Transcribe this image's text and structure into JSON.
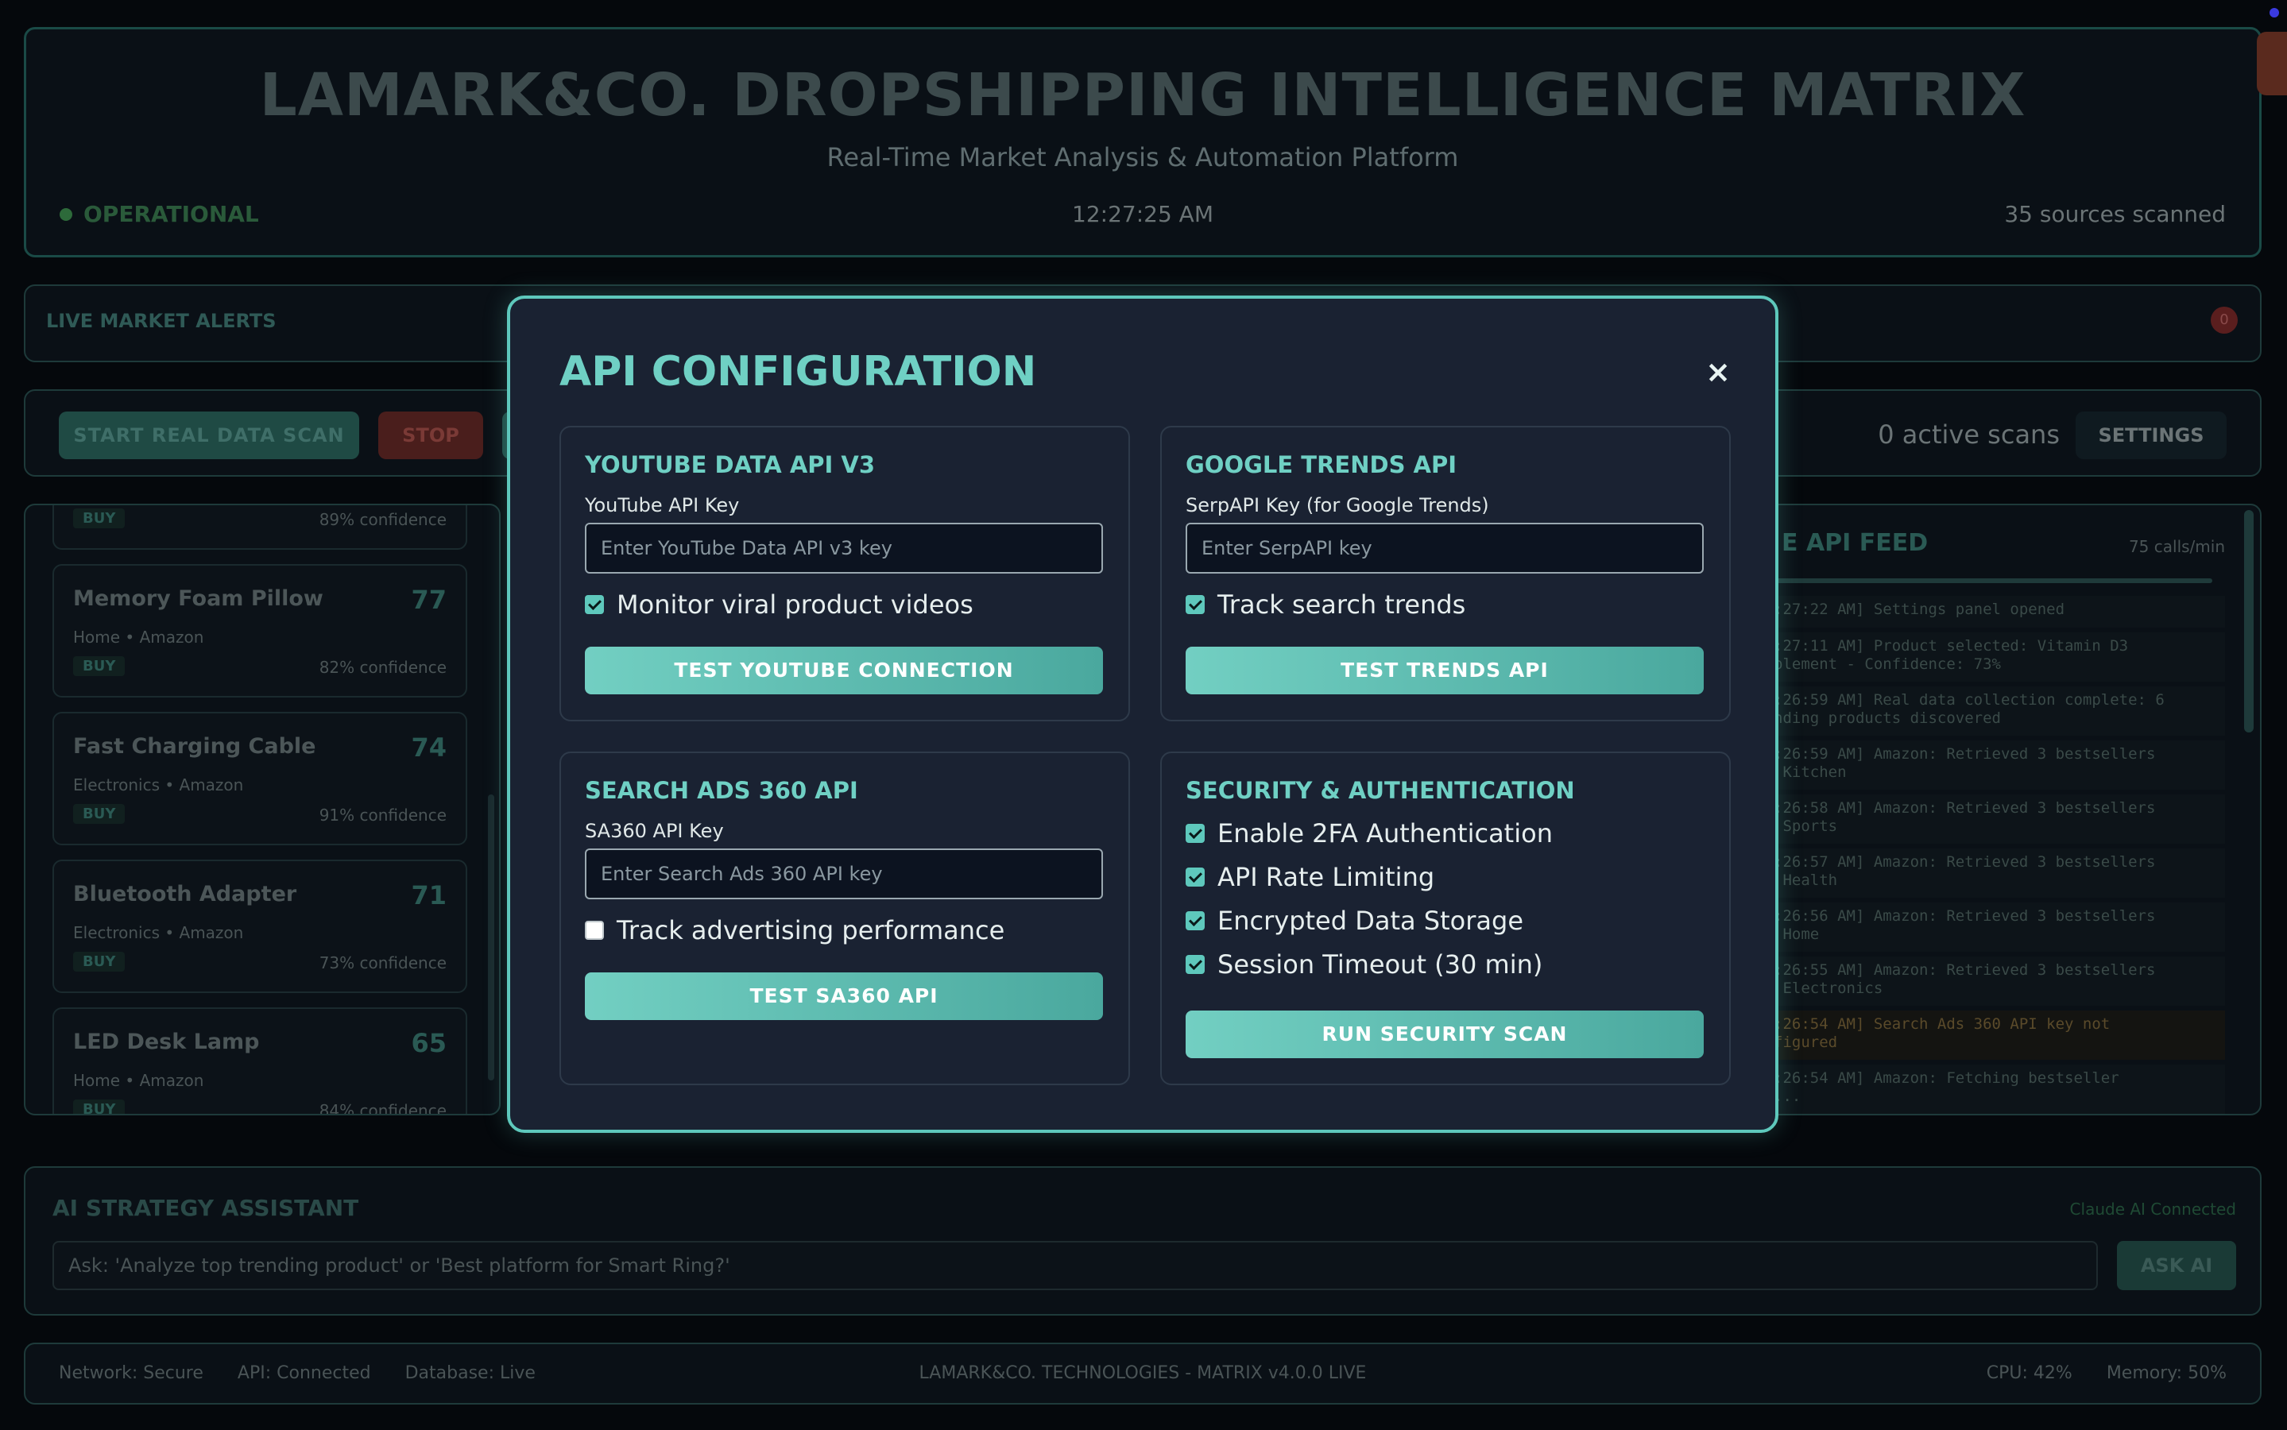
{
  "header": {
    "title": "LAMARK&CO. DROPSHIPPING INTELLIGENCE MATRIX",
    "subtitle": "Real-Time Market Analysis & Automation Platform",
    "status": "OPERATIONAL",
    "clock": "12:27:25 AM",
    "sources": "35 sources scanned"
  },
  "alerts": {
    "label": "LIVE MARKET ALERTS",
    "count": "0"
  },
  "controls": {
    "start_label": "START REAL DATA SCAN",
    "stop_label": "STOP",
    "active_scans": "0 active scans",
    "settings_label": "SETTINGS"
  },
  "products": [
    {
      "name": "",
      "score": "",
      "meta": "",
      "action": "BUY",
      "confidence": "89% confidence"
    },
    {
      "name": "Memory Foam Pillow",
      "score": "77",
      "meta": "Home • Amazon",
      "action": "BUY",
      "confidence": "82% confidence"
    },
    {
      "name": "Fast Charging Cable",
      "score": "74",
      "meta": "Electronics • Amazon",
      "action": "BUY",
      "confidence": "91% confidence"
    },
    {
      "name": "Bluetooth Adapter",
      "score": "71",
      "meta": "Electronics • Amazon",
      "action": "BUY",
      "confidence": "73% confidence"
    },
    {
      "name": "LED Desk Lamp",
      "score": "65",
      "meta": "Home • Amazon",
      "action": "BUY",
      "confidence": "84% confidence"
    }
  ],
  "feed": {
    "title": "E API FEED",
    "rate": "75 calls/min",
    "logs": [
      {
        "text": ":27:22 AM] Settings panel opened",
        "level": "info"
      },
      {
        "text": ":27:11 AM] Product selected: Vitamin D3\nplement - Confidence: 73%",
        "level": "info"
      },
      {
        "text": ":26:59 AM] Real data collection complete: 6\nnding products discovered",
        "level": "info"
      },
      {
        "text": ":26:59 AM] Amazon: Retrieved 3 bestsellers\n Kitchen",
        "level": "info"
      },
      {
        "text": ":26:58 AM] Amazon: Retrieved 3 bestsellers\n Sports",
        "level": "info"
      },
      {
        "text": ":26:57 AM] Amazon: Retrieved 3 bestsellers\n Health",
        "level": "info"
      },
      {
        "text": ":26:56 AM] Amazon: Retrieved 3 bestsellers\n Home",
        "level": "info"
      },
      {
        "text": ":26:55 AM] Amazon: Retrieved 3 bestsellers\n Electronics",
        "level": "info"
      },
      {
        "text": ":26:54 AM] Search Ads 360 API key not\nfigured",
        "level": "warn"
      },
      {
        "text": ":26:54 AM] Amazon: Fetching bestseller\n...",
        "level": "info"
      }
    ]
  },
  "ai": {
    "title": "AI STRATEGY ASSISTANT",
    "status": "Claude AI Connected",
    "placeholder": "Ask: 'Analyze top trending product' or 'Best platform for Smart Ring?'",
    "button": "ASK AI"
  },
  "footer": {
    "network": "Network: Secure",
    "api": "API: Connected",
    "database": "Database: Live",
    "center": "LAMARK&CO. TECHNOLOGIES - MATRIX v4.0.0 LIVE",
    "cpu": "CPU: 42%",
    "memory": "Memory: 50%"
  },
  "modal": {
    "title": "API CONFIGURATION",
    "close": "×",
    "youtube": {
      "title": "YOUTUBE DATA API V3",
      "field_label": "YouTube API Key",
      "placeholder": "Enter YouTube Data API v3 key",
      "checkbox": "Monitor viral product videos",
      "checked": true,
      "button": "TEST YOUTUBE CONNECTION"
    },
    "trends": {
      "title": "GOOGLE TRENDS API",
      "field_label": "SerpAPI Key (for Google Trends)",
      "placeholder": "Enter SerpAPI key",
      "checkbox": "Track search trends",
      "checked": true,
      "button": "TEST TRENDS API"
    },
    "sa360": {
      "title": "SEARCH ADS 360 API",
      "field_label": "SA360 API Key",
      "placeholder": "Enter Search Ads 360 API key",
      "checkbox": "Track advertising performance",
      "checked": false,
      "button": "TEST SA360 API"
    },
    "security": {
      "title": "SECURITY & AUTHENTICATION",
      "options": [
        {
          "label": "Enable 2FA Authentication",
          "checked": true
        },
        {
          "label": "API Rate Limiting",
          "checked": true
        },
        {
          "label": "Encrypted Data Storage",
          "checked": true
        },
        {
          "label": "Session Timeout (30 min)",
          "checked": true
        }
      ],
      "button": "RUN SECURITY SCAN"
    }
  }
}
